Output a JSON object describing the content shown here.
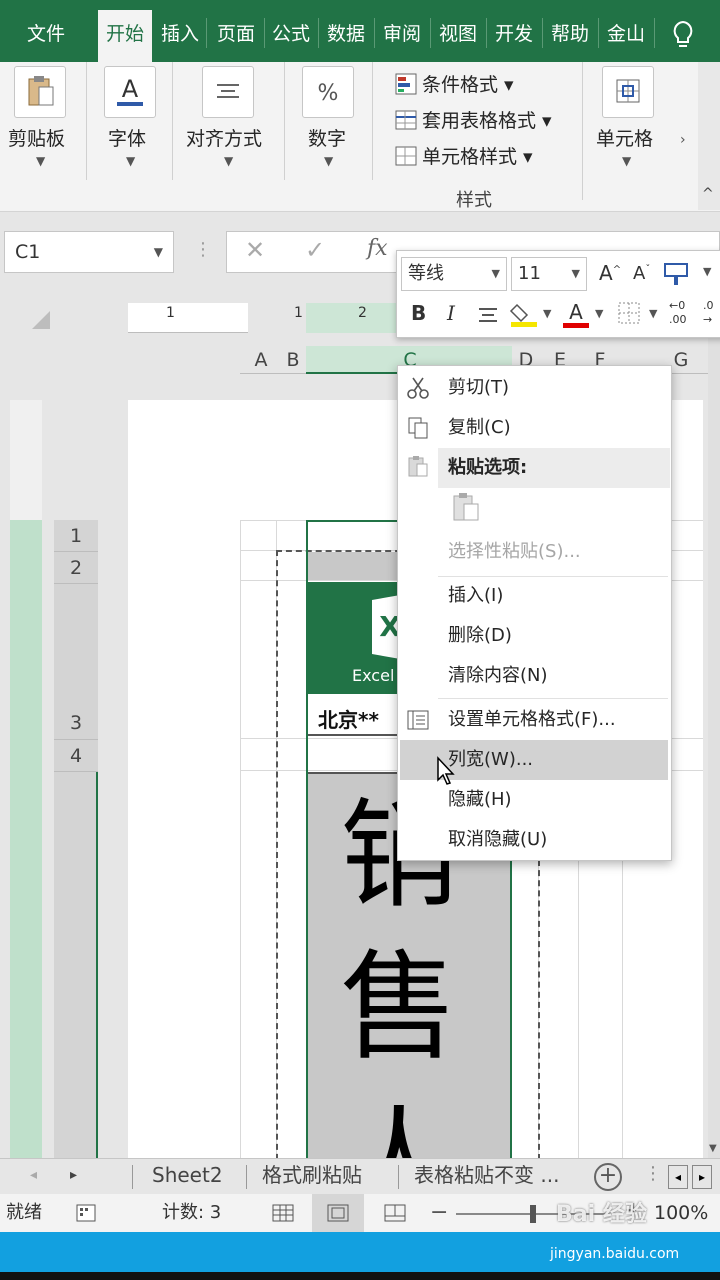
{
  "tabs": [
    "文件",
    "开始",
    "插入",
    "页面",
    "公式",
    "数据",
    "审阅",
    "视图",
    "开发",
    "帮助",
    "金山"
  ],
  "ribbon": {
    "clipboard": "剪贴板",
    "font": "字体",
    "align": "对齐方式",
    "number": "数字",
    "cond_format": "条件格式",
    "table_format": "套用表格格式",
    "cell_style": "单元格样式",
    "styles_group": "样式",
    "cells": "单元格"
  },
  "formula_bar": {
    "name_box": "C1",
    "fx": "fx"
  },
  "columns": [
    "A",
    "B",
    "C",
    "D",
    "E",
    "F",
    "G"
  ],
  "rows": [
    "1",
    "2",
    "3",
    "4"
  ],
  "ruler": [
    "1",
    "1",
    "2"
  ],
  "cell_text": {
    "logo_caption": "Excel",
    "address": "北京**",
    "big_chars": [
      "销",
      "售",
      "人"
    ]
  },
  "mini_toolbar": {
    "font": "等线",
    "size": "11",
    "bold": "B",
    "italic": "I"
  },
  "context_menu": {
    "cut": "剪切(T)",
    "copy": "复制(C)",
    "paste_options": "粘贴选项:",
    "paste_special": "选择性粘贴(S)...",
    "insert": "插入(I)",
    "delete": "删除(D)",
    "clear": "清除内容(N)",
    "format_cells": "设置单元格格式(F)...",
    "col_width": "列宽(W)...",
    "hide": "隐藏(H)",
    "unhide": "取消隐藏(U)"
  },
  "sheet_tabs": [
    "Sheet2",
    "格式刷粘贴",
    "表格粘贴不变 ..."
  ],
  "status": {
    "ready": "就绪",
    "count": "计数: 3",
    "zoom": "100%"
  },
  "watermark": {
    "line1": "Bai 经验",
    "line2": "jingyan.baidu.com"
  },
  "colors": {
    "accent": "#217346",
    "blue_bar": "#12a0e0"
  }
}
